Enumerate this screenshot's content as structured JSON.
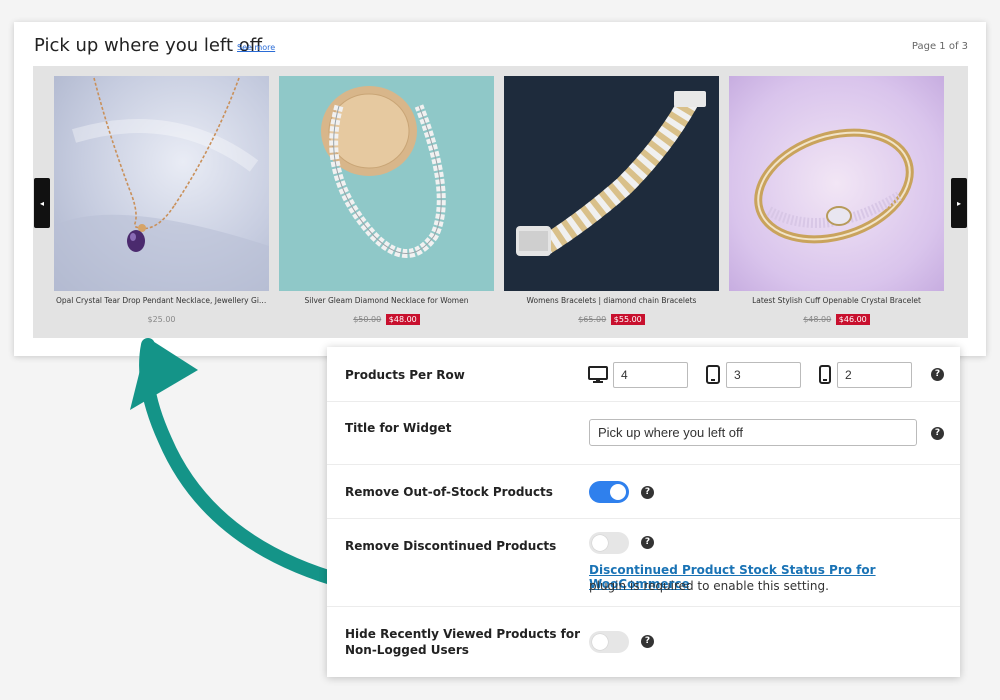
{
  "widget": {
    "title": "Pick up where you left off",
    "see_more": "See more",
    "page_indicator": "Page 1 of 3",
    "products": [
      {
        "name": "Opal Crystal Tear Drop Pendant Necklace, Jewellery Gift ...",
        "price": "$25.00",
        "old_price": "",
        "sale_price": ""
      },
      {
        "name": "Silver Gleam Diamond Necklace for Women",
        "price": "",
        "old_price": "$50.00",
        "sale_price": "$48.00"
      },
      {
        "name": "Womens Bracelets | diamond chain Bracelets",
        "price": "",
        "old_price": "$65.00",
        "sale_price": "$55.00"
      },
      {
        "name": "Latest Stylish Cuff Openable Crystal Bracelet",
        "price": "",
        "old_price": "$48.00",
        "sale_price": "$46.00"
      }
    ],
    "prev_arrow": "◂",
    "next_arrow": "▸"
  },
  "settings": {
    "products_per_row": {
      "label": "Products Per Row",
      "desktop": "4",
      "tablet": "3",
      "mobile": "2"
    },
    "title_for_widget": {
      "label": "Title for Widget",
      "value": "Pick up where you left off"
    },
    "remove_out_of_stock": {
      "label": "Remove Out-of-Stock Products",
      "enabled": true
    },
    "remove_discontinued": {
      "label": "Remove Discontinued Products",
      "enabled": false,
      "plugin_link": "Discontinued Product Stock Status Pro for WooCommerce",
      "plugin_note": "plugin is required to enable this setting."
    },
    "hide_for_guests": {
      "label_line1": "Hide Recently Viewed Products for",
      "label_line2": "Non-Logged Users",
      "enabled": false
    },
    "help_glyph": "?"
  },
  "colors": {
    "accent_blue": "#2f80ed",
    "sale_red": "#c8102e",
    "arrow_teal": "#149488",
    "link_blue": "#1a73b5"
  }
}
